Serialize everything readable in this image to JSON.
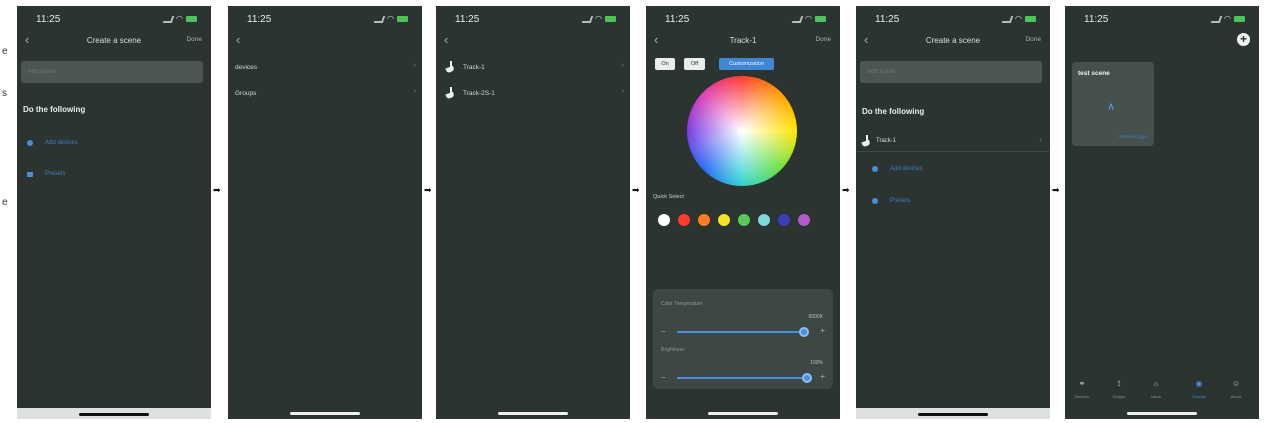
{
  "left_cut_text": [
    "e",
    "s",
    "e"
  ],
  "time": "11:25",
  "screen1": {
    "title": "Create a scene",
    "done": "Done",
    "name_placeholder": "Add scene",
    "section": "Do the following",
    "actions": [
      "Add devices",
      "Presets"
    ]
  },
  "screen2": {
    "items": [
      "devices",
      "Groups"
    ]
  },
  "screen3": {
    "items": [
      "Track-1",
      "Track-2S-1"
    ]
  },
  "screen4": {
    "title": "Track-1",
    "done": "Done",
    "segments": [
      "On",
      "Off",
      "Customization"
    ],
    "quick_select_label": "Quick Select",
    "swatches": [
      "#ffffff",
      "#ff3b2f",
      "#ff7b22",
      "#f5e02a",
      "#58c95a",
      "#7fd8d8",
      "#3a3fb8",
      "#b25ac9"
    ],
    "color_temperature_label": "Color Temperature",
    "color_temperature_value": "6500K",
    "color_temperature_level": 0.98,
    "brightness_label": "Brightness",
    "brightness_value": "100%",
    "brightness_level": 1.0
  },
  "screen5": {
    "title": "Create a scene",
    "done": "Done",
    "name_placeholder": "Add scene",
    "section": "Do the following",
    "device": "Track-1",
    "actions": [
      "Add devices",
      "Presets"
    ]
  },
  "screen6": {
    "card_title": "test scene",
    "card_link": "Manual trigger",
    "tabs": [
      "Devices",
      "Groups",
      "Ideas",
      "Scenes",
      "About"
    ],
    "active_tab": 3
  },
  "colors": {
    "background": "#2b3431",
    "accent": "#4a8fd8",
    "card": "#46504d"
  }
}
